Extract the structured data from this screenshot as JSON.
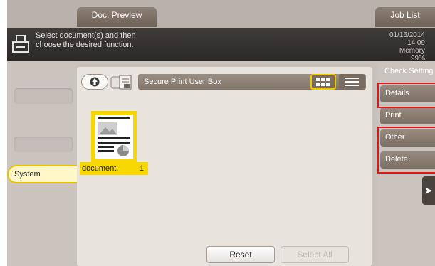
{
  "tabs": {
    "doc_preview": "Doc. Preview",
    "job_list": "Job List"
  },
  "message": {
    "line1": "Select document(s) and then",
    "line2": "choose the desired function.",
    "date": "01/16/2014",
    "time": "14:09",
    "memory_label": "Memory",
    "memory_value": "99%"
  },
  "left_panel": {
    "system_tab": "System"
  },
  "box": {
    "path": "Secure Print User Box",
    "icons": {
      "up": "up-arrow-icon",
      "box": "box-folder-icon",
      "thumbnail_view": "grid-view-icon",
      "list_view": "list-view-icon"
    }
  },
  "documents": [
    {
      "name": "document.",
      "count": "1"
    }
  ],
  "buttons": {
    "reset": "Reset",
    "select_all": "Select All"
  },
  "right_panel": {
    "heading": "Check Setting",
    "items": [
      "Details",
      "Print",
      "Other",
      "Delete"
    ]
  },
  "colors": {
    "highlight": "#f6d800",
    "alert_outline": "#e0141a",
    "accent_brown": "#7a6c60"
  }
}
